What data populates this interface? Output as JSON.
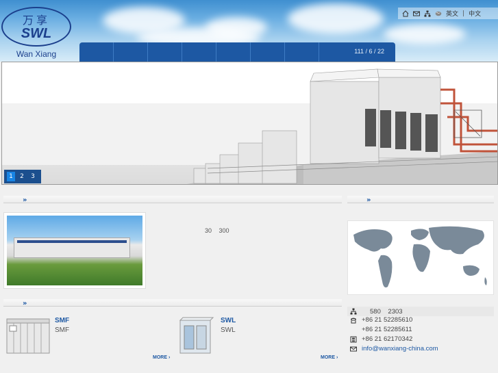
{
  "brand": {
    "logo_cn": "万享",
    "logo_abbr": "SWL",
    "logo_en": "Wan Xiang"
  },
  "toplinks": {
    "icons": [
      "home-icon",
      "mail-icon",
      "sitemap-icon",
      "globe-icon"
    ],
    "lang_en": "英文",
    "separator": "|",
    "lang_cn": "中文"
  },
  "nav": {
    "date": "111 / 6 / 22"
  },
  "banner": {
    "slides": [
      "1",
      "2",
      "3"
    ],
    "active_slide": "1"
  },
  "about": {
    "stat_a": "30",
    "stat_b": "300"
  },
  "contact": {
    "address_text": "580    2303",
    "tel1": "+86 21 52285610",
    "tel2": "+86 21 52285611",
    "fax": "+86 21 62170342",
    "email": "info@wanxiang-china.com"
  },
  "products": [
    {
      "title": "SMF",
      "subtitle": "SMF",
      "more": "MORE ›"
    },
    {
      "title": "SWL",
      "subtitle": "SWL",
      "more": "MORE ›"
    }
  ],
  "section_arrow": "»",
  "colors": {
    "brand_blue": "#1d58a3",
    "logo_blue": "#1b3f8c",
    "active_slide": "#1784e4"
  }
}
